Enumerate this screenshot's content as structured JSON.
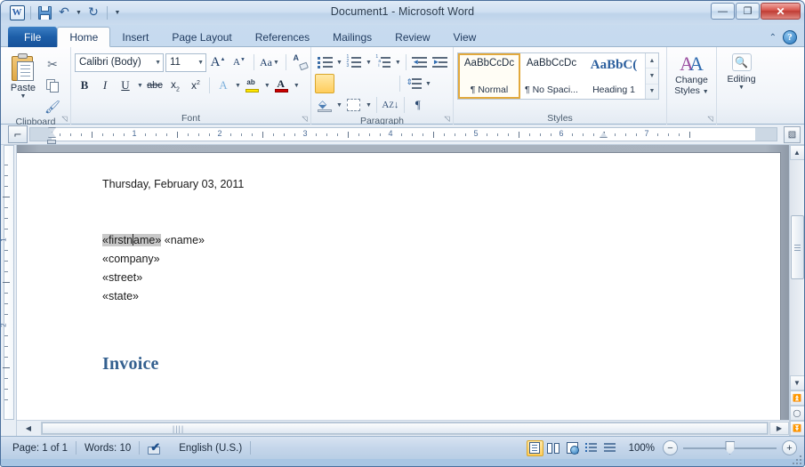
{
  "window": {
    "title": "Document1  -  Microsoft Word",
    "app_logo": "W",
    "quick_access": [
      {
        "name": "save-icon",
        "label": "Save"
      },
      {
        "name": "undo-icon",
        "label": "Undo"
      },
      {
        "name": "redo-icon",
        "label": "Redo"
      },
      {
        "name": "customize-qat-icon",
        "label": "Customize Quick Access Toolbar"
      }
    ],
    "controls": {
      "minimize": "—",
      "maximize": "❐",
      "close": "✕"
    }
  },
  "ribbon": {
    "tabs": [
      {
        "label": "File",
        "type": "file"
      },
      {
        "label": "Home",
        "active": true
      },
      {
        "label": "Insert"
      },
      {
        "label": "Page Layout"
      },
      {
        "label": "References"
      },
      {
        "label": "Mailings"
      },
      {
        "label": "Review"
      },
      {
        "label": "View"
      }
    ],
    "help_label": "?",
    "collapse_label": "⌃",
    "groups": {
      "clipboard": {
        "label": "Clipboard",
        "paste_label": "Paste",
        "items": [
          {
            "name": "cut-icon",
            "label": "Cut"
          },
          {
            "name": "copy-icon",
            "label": "Copy"
          },
          {
            "name": "format-painter-icon",
            "label": "Format Painter"
          }
        ]
      },
      "font": {
        "label": "Font",
        "font_name": "Calibri (Body)",
        "font_size": "11",
        "buttons": [
          {
            "name": "grow-font-button",
            "label": "A"
          },
          {
            "name": "shrink-font-button",
            "label": "A"
          },
          {
            "name": "change-case-button",
            "label": "Aa"
          },
          {
            "name": "clear-formatting-button",
            "label": "Clear Formatting"
          },
          {
            "name": "bold-button",
            "label": "B"
          },
          {
            "name": "italic-button",
            "label": "I"
          },
          {
            "name": "underline-button",
            "label": "U"
          },
          {
            "name": "strikethrough-button",
            "label": "abc"
          },
          {
            "name": "subscript-button",
            "label": "x"
          },
          {
            "name": "superscript-button",
            "label": "x"
          },
          {
            "name": "text-effects-button",
            "label": "A"
          },
          {
            "name": "text-highlight-button",
            "label": "ab"
          },
          {
            "name": "font-color-button",
            "label": "A"
          }
        ]
      },
      "paragraph": {
        "label": "Paragraph",
        "buttons": [
          {
            "name": "bullets-button",
            "label": "Bullets"
          },
          {
            "name": "numbering-button",
            "label": "Numbering"
          },
          {
            "name": "multilevel-list-button",
            "label": "Multilevel List"
          },
          {
            "name": "decrease-indent-button",
            "label": "Decrease Indent"
          },
          {
            "name": "increase-indent-button",
            "label": "Increase Indent"
          },
          {
            "name": "align-left-button",
            "label": "Align Left",
            "selected": true
          },
          {
            "name": "align-center-button",
            "label": "Center"
          },
          {
            "name": "align-right-button",
            "label": "Align Right"
          },
          {
            "name": "justify-button",
            "label": "Justify"
          },
          {
            "name": "line-spacing-button",
            "label": "Line and Paragraph Spacing"
          },
          {
            "name": "shading-button",
            "label": "Shading"
          },
          {
            "name": "borders-button",
            "label": "Borders"
          },
          {
            "name": "sort-button",
            "label": "Sort"
          },
          {
            "name": "show-formatting-marks-button",
            "label": "¶"
          }
        ]
      },
      "styles": {
        "label": "Styles",
        "gallery": [
          {
            "preview": "AaBbCcDc",
            "name": "¶ Normal",
            "selected": true,
            "kind": "normal"
          },
          {
            "preview": "AaBbCcDc",
            "name": "¶ No Spaci...",
            "selected": false,
            "kind": "normal"
          },
          {
            "preview": "AaBbC(",
            "name": "Heading 1",
            "selected": false,
            "kind": "heading"
          }
        ],
        "scroll": [
          "▲",
          "▼",
          "▼"
        ]
      },
      "change_styles": {
        "label_line1": "Change",
        "label_line2": "Styles",
        "icon": "AA"
      },
      "editing": {
        "label": "Editing",
        "icon": "find-binoculars-icon"
      }
    }
  },
  "ruler": {
    "tab_selector": "⌐",
    "horizontal_numbers": [
      "1",
      "2",
      "3",
      "4",
      "5",
      "6",
      "7"
    ],
    "vertical_numbers": [
      "1",
      "2"
    ],
    "left_indent_inches": 0.25,
    "right_indent_inches": 6.5,
    "corner_icon": "show-hide-ruler-icon"
  },
  "document": {
    "lines": [
      {
        "text": "Thursday, February 03, 2011",
        "style": "body"
      },
      {
        "text": "",
        "style": "body"
      },
      {
        "text": "",
        "style": "body"
      },
      {
        "fields": [
          {
            "text": "«firstname»",
            "shaded": true,
            "caret_after_chars": 7
          },
          {
            "text": " «name»",
            "shaded": false
          }
        ],
        "style": "body"
      },
      {
        "text": "«company»",
        "style": "body"
      },
      {
        "text": "«street»",
        "style": "body"
      },
      {
        "text": "«state»",
        "style": "body"
      },
      {
        "text": "",
        "style": "body"
      },
      {
        "text": "",
        "style": "body"
      },
      {
        "text": "Invoice",
        "style": "heading1"
      }
    ]
  },
  "status_bar": {
    "page": "Page: 1 of 1",
    "words": "Words: 10",
    "proofing_icon": "spelling-grammar-check-icon",
    "language": "English (U.S.)",
    "views": [
      {
        "name": "print-layout-view-button",
        "label": "Print Layout",
        "selected": true
      },
      {
        "name": "full-screen-reading-view-button",
        "label": "Full Screen Reading",
        "selected": false
      },
      {
        "name": "web-layout-view-button",
        "label": "Web Layout",
        "selected": false
      },
      {
        "name": "outline-view-button",
        "label": "Outline",
        "selected": false
      },
      {
        "name": "draft-view-button",
        "label": "Draft",
        "selected": false
      }
    ],
    "zoom_level": "100%",
    "zoom_out_label": "−",
    "zoom_in_label": "+"
  },
  "colors": {
    "accent_blue": "#1d5ea8",
    "heading_blue": "#34608f",
    "selection_gold": "#ffcd5c",
    "field_shade": "#c8c8c8",
    "close_red": "#bf3b33"
  }
}
